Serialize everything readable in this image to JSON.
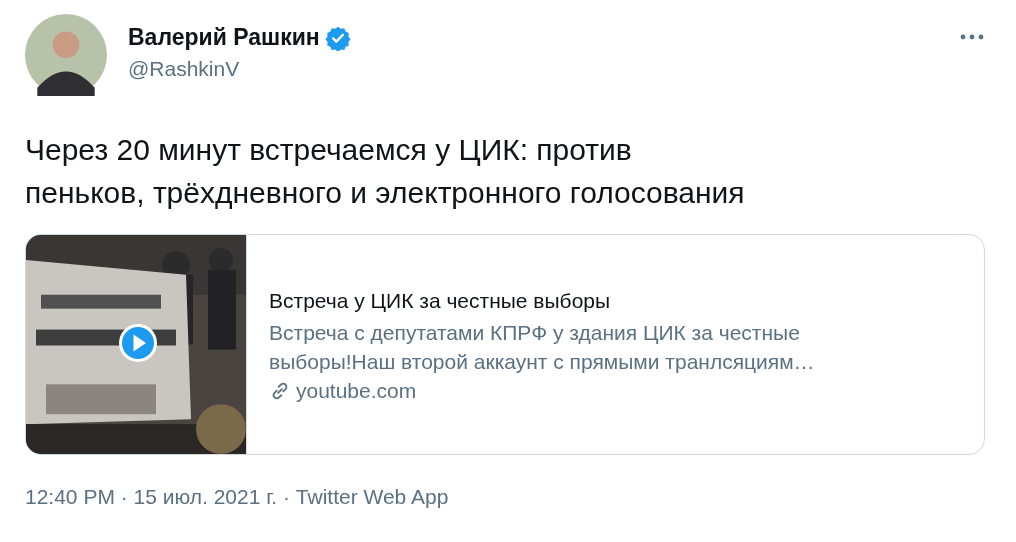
{
  "author": {
    "name": "Валерий Рашкин",
    "handle": "@RashkinV",
    "verified": true
  },
  "text_lines": [
    "Через 20 минут встречаемся у ЦИК: против",
    "пеньков, трёхдневного и электронного голосования"
  ],
  "card": {
    "media": {
      "kind": "picture",
      "video": true
    },
    "title": "Встреча у ЦИК за честные выборы",
    "description_lines": [
      "Встреча с депутатами КПРФ у здания ЦИК за честные",
      "выборы!Наш второй аккаунт с прямыми транлсяциям…"
    ],
    "domain": "youtube.com"
  },
  "meta": "12:40 PM · 15 июл. 2021 г. · Twitter Web App"
}
